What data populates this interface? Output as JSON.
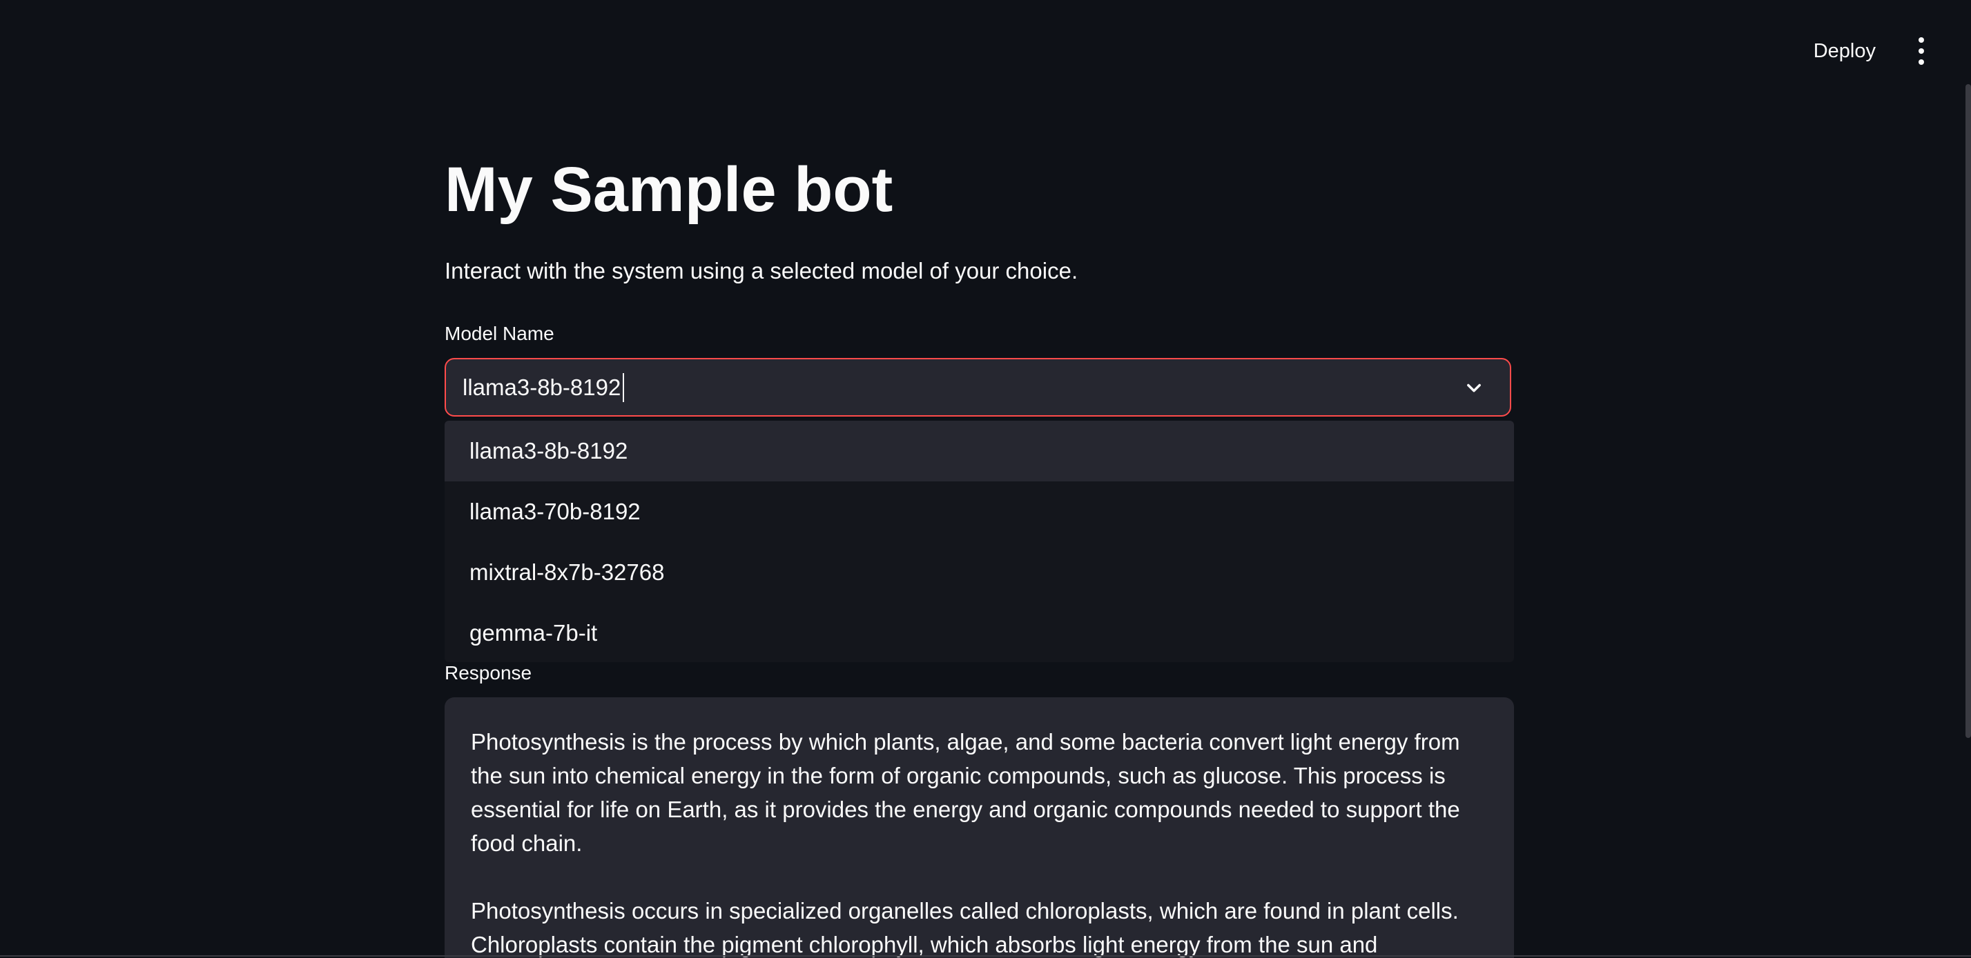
{
  "toolbar": {
    "deploy_label": "Deploy",
    "menu_icon": "vertical-ellipsis-icon"
  },
  "main": {
    "title": "My Sample bot",
    "subtitle": "Interact with the system using a selected model of your choice."
  },
  "model_select": {
    "label": "Model Name",
    "value": "llama3-8b-8192",
    "chevron_icon": "chevron-down-icon",
    "accent_color": "#ff4b4b",
    "options": [
      "llama3-8b-8192",
      "llama3-70b-8192",
      "mixtral-8x7b-32768",
      "gemma-7b-it"
    ],
    "highlighted_option": "llama3-8b-8192"
  },
  "response": {
    "label": "Response",
    "paragraphs": [
      "Photosynthesis is the process by which plants, algae, and some bacteria convert light energy from the sun into chemical energy in the form of organic compounds, such as glucose. This process is essential for life on Earth, as it provides the energy and organic compounds needed to support the food chain.",
      "Photosynthesis occurs in specialized organelles called chloroplasts, which are found in plant cells. Chloroplasts contain the pigment chlorophyll, which absorbs light energy from the sun and"
    ]
  },
  "theme": {
    "background": "#0e1117",
    "surface": "#262730",
    "text": "#fafafa"
  }
}
